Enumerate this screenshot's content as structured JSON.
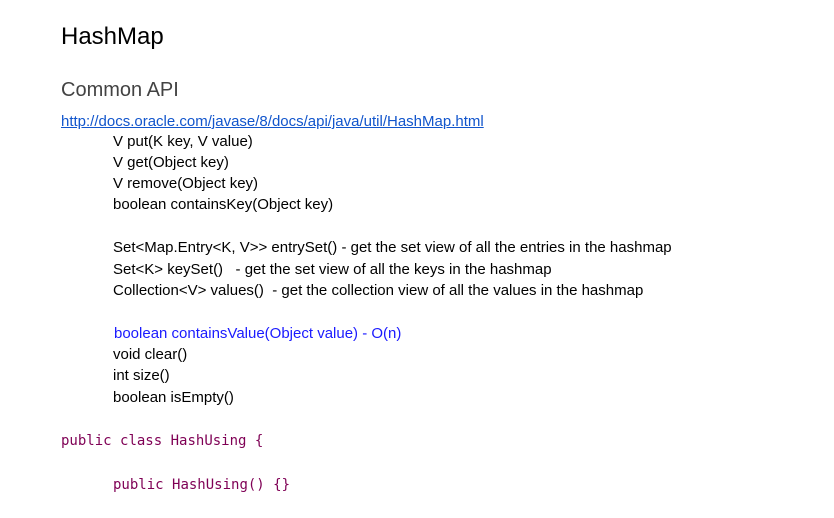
{
  "document": {
    "title": "HashMap",
    "section_heading": "Common API",
    "link_text": "http://docs.oracle.com/javase/8/docs/api/java/util/HashMap.html",
    "api_lines": [
      "V put(K key, V value)",
      "V get(Object key)",
      "V remove(Object key)",
      "boolean containsKey(Object key)"
    ],
    "view_lines": [
      "Set<Map.Entry<K, V>> entrySet() - get the set view of all the entries in the hashmap",
      "Set<K> keySet()   - get the set view of all the keys in the hashmap",
      "Collection<V> values()  - get the collection view of all the values in the hashmap"
    ],
    "highlighted_line": "boolean containsValue(Object value) - O(n)",
    "misc_lines": [
      "void clear()",
      "int size()",
      "boolean isEmpty()"
    ],
    "code": {
      "line1": {
        "kw1": "public",
        "kw2": "class",
        "name": "HashUsing",
        "brace": "{"
      },
      "line2": {
        "kw1": "public",
        "name": "HashUsing()",
        "body": "{}"
      }
    },
    "colors": {
      "link": "#1155cc",
      "highlight": "#1a1aff",
      "code_keyword": "#7f0055",
      "subheading": "#434343"
    }
  }
}
